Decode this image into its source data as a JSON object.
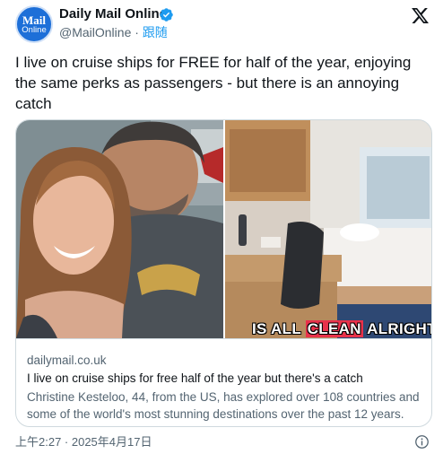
{
  "account": {
    "display_name": "Daily Mail Online",
    "handle": "@MailOnline",
    "separator": " · ",
    "follow_label": "跟随",
    "avatar_logo_line1": "Mail",
    "avatar_logo_line2": "Online"
  },
  "tweet": {
    "text": "I live on cruise ships for FREE for half of the year, enjoying the same perks as passengers - but there is an annoying catch"
  },
  "link_card": {
    "domain": "dailymail.co.uk",
    "title": "I live on cruise ships for free half of the year but there's a catch",
    "description": "Christine Kesteloo, 44, from the US, has explored over 108 countries and some of the world's most stunning destinations over the past 12 years.",
    "caption_before": "IS ALL ",
    "caption_highlight": "CLEAN",
    "caption_after": " ALRIGHT"
  },
  "footer": {
    "timestamp": "上午2:27 · 2025年4月17日"
  },
  "icons": {
    "verified": "verified-badge-icon",
    "x_logo": "x-logo-icon",
    "info": "info-icon"
  },
  "colors": {
    "accent": "#1d9bf0",
    "secondary_text": "#536471",
    "brand_blue": "#1d6fd8",
    "caption_highlight": "#e8324b"
  }
}
